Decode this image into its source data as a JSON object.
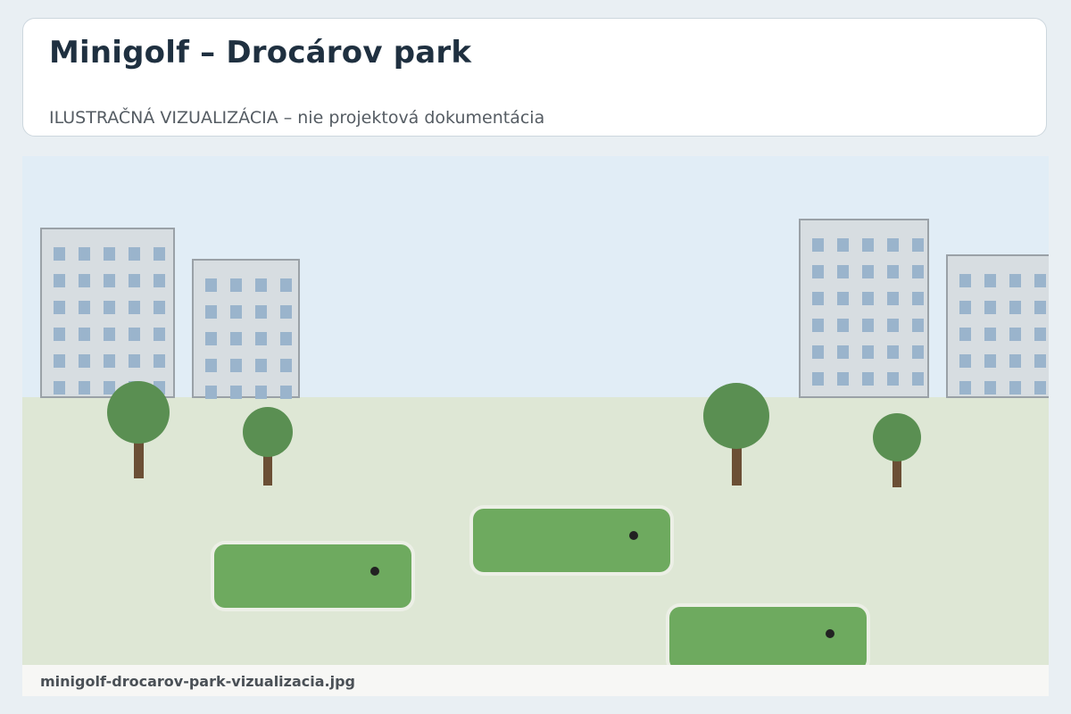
{
  "header": {
    "title": "Minigolf – Drocárov park",
    "subtitle": "ILUSTRAČNÁ VIZUALIZÁCIA – nie projektová dokumentácia"
  },
  "image": {
    "caption": "minigolf-drocarov-park-vizualizacia.jpg"
  },
  "colors": {
    "page_background": "#e9eff3",
    "sky": "#e1edf6",
    "grass": "#dee7d5",
    "building": "#d7dde1",
    "building_outline": "#9aa1a7",
    "window": "#9ab4cc",
    "tree_crown": "#5a8f52",
    "tree_trunk": "#6b4f35",
    "green": "#6eaa5f",
    "hole": "#222222",
    "title_text": "#1f3040"
  },
  "scene": {
    "building_count": 4,
    "tree_count": 4,
    "putting_green_count": 3
  }
}
